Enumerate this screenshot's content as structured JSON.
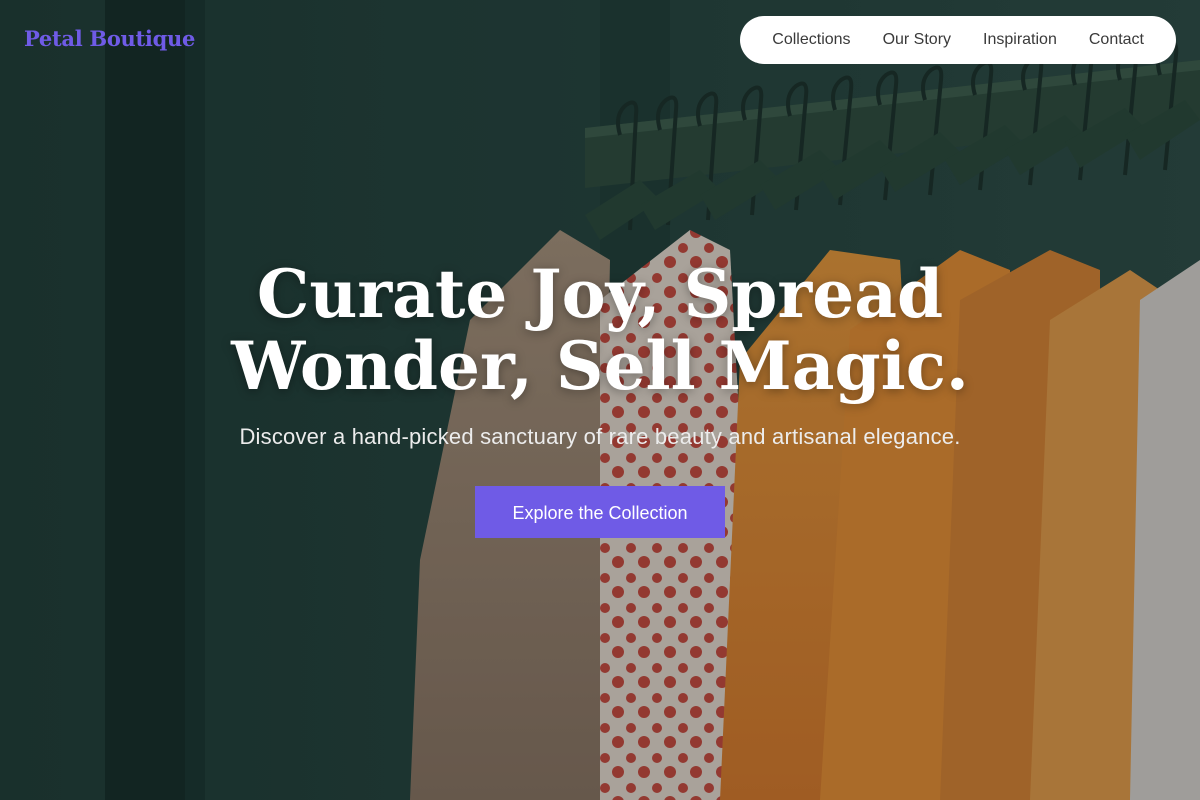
{
  "brand": {
    "name": "Petal Boutique",
    "color": "#6f5be6"
  },
  "nav": {
    "links": [
      "Collections",
      "Our Story",
      "Inspiration",
      "Contact"
    ]
  },
  "hero": {
    "title": "Curate Joy, Spread Wonder, Sell Magic.",
    "subtitle": "Discover a hand-picked sanctuary of rare beauty and artisanal elegance.",
    "cta_label": "Explore the Collection",
    "background_image": "clothing-rack-photo"
  },
  "colors": {
    "accent": "#6f5be6",
    "nav_bg": "#ffffff",
    "text_light": "#ffffff"
  }
}
